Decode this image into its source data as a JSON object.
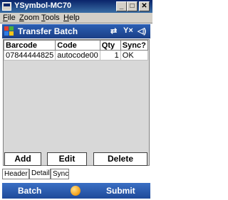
{
  "window": {
    "title": "YSymbol-MC70",
    "minimize": "_",
    "maximize": "□",
    "close": "✕"
  },
  "menu": {
    "file": "File",
    "file_key": "F",
    "zoom": "Zoom",
    "zoom_key": "Z",
    "tools": "Tools",
    "tools_key": "T",
    "help": "Help",
    "help_key": "H"
  },
  "app": {
    "title": "Transfer Batch",
    "status_icons": [
      "connectivity-icon",
      "signal-icon",
      "volume-icon"
    ]
  },
  "grid": {
    "columns": [
      "Barcode",
      "Code",
      "Qty",
      "Sync?"
    ],
    "rows": [
      [
        "07844444825",
        "autocode00",
        "1",
        "OK"
      ]
    ]
  },
  "buttons": {
    "add": "Add",
    "edit": "Edit",
    "delete": "Delete"
  },
  "tabs": {
    "header": "Header",
    "detail": "Detail",
    "sync": "Sync"
  },
  "softkeys": {
    "left": "Batch",
    "right": "Submit"
  },
  "colors": {
    "title_blue": "#1b3f86",
    "softkey_blue": "#2b5fb4",
    "orb": "#f5a623"
  }
}
